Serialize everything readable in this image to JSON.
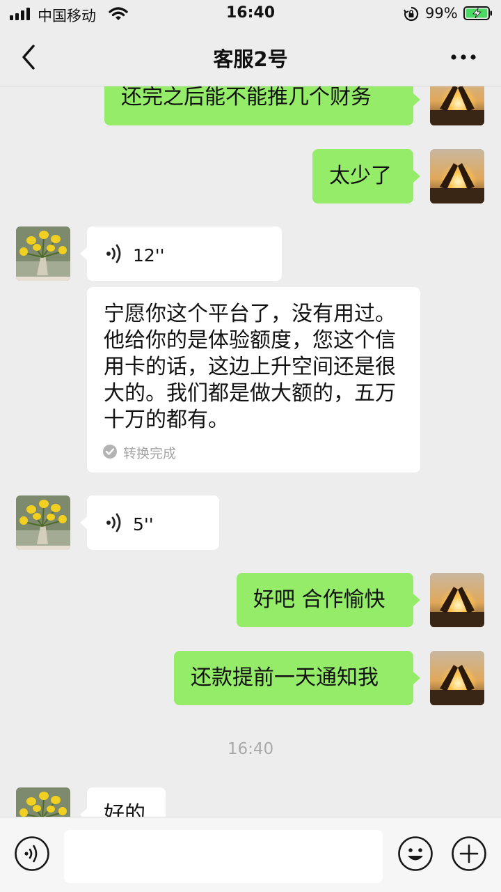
{
  "status_bar": {
    "carrier": "中国移动",
    "time": "16:40",
    "battery_percent": "99%",
    "battery_level": 0.99,
    "icons": [
      "signal-icon",
      "wifi-icon",
      "rotation-lock-icon",
      "battery-charging-icon"
    ]
  },
  "header": {
    "title": "客服2号",
    "back_icon": "chevron-left-icon",
    "more_icon": "more-dots-icon"
  },
  "messages": [
    {
      "sender": "me",
      "type": "text",
      "text": "还完之后能不能推几个财务"
    },
    {
      "sender": "me",
      "type": "text",
      "text": "太少了"
    },
    {
      "sender": "other",
      "type": "voice",
      "duration": "12''",
      "transcript": "宁愿你这个平台了，没有用过。他给你的是体验额度，您这个信用卡的话，这边上升空间还是很大的。我们都是做大额的，五万十万的都有。",
      "transcript_status": "转换完成"
    },
    {
      "sender": "other",
      "type": "voice",
      "duration": "5''"
    },
    {
      "sender": "me",
      "type": "text",
      "text": "好吧 合作愉快"
    },
    {
      "sender": "me",
      "type": "text",
      "text": "还款提前一天通知我"
    },
    {
      "type": "timestamp",
      "text": "16:40"
    },
    {
      "sender": "other",
      "type": "text",
      "text": "好的"
    }
  ],
  "input_bar": {
    "placeholder": "",
    "icons": [
      "voice-input-icon",
      "emoji-icon",
      "plus-icon"
    ]
  },
  "colors": {
    "background": "#ededed",
    "my_bubble": "#95ec69",
    "other_bubble": "#ffffff",
    "battery_green": "#4cd964",
    "timestamp_text": "#a9a9a9"
  }
}
